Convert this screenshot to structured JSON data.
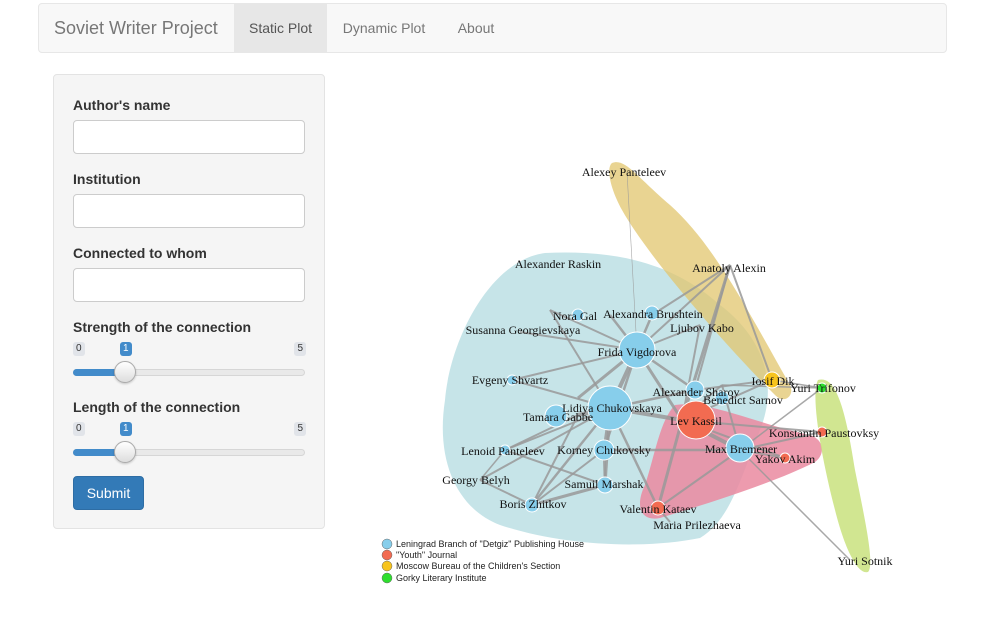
{
  "navbar": {
    "brand": "Soviet Writer Project",
    "tabs": [
      {
        "label": "Static Plot",
        "active": true
      },
      {
        "label": "Dynamic Plot",
        "active": false
      },
      {
        "label": "About",
        "active": false
      }
    ]
  },
  "form": {
    "author_label": "Author's name",
    "author_value": "",
    "institution_label": "Institution",
    "institution_value": "",
    "connected_label": "Connected to whom",
    "connected_value": "",
    "strength": {
      "label": "Strength of the connection",
      "min": "0",
      "max": "5",
      "value": "1"
    },
    "length": {
      "label": "Length of the connection",
      "min": "0",
      "max": "5",
      "value": "1"
    },
    "submit_label": "Submit"
  },
  "colors": {
    "leningrad": "#87ceeb",
    "youth": "#f26b51",
    "moscow": "#f7c41d",
    "gorky": "#2ede2e",
    "accent": "#337ab7"
  },
  "graph": {
    "nodes": [
      {
        "id": "alexey_panteleev",
        "label": "Alexey Panteleev",
        "group": "none"
      },
      {
        "id": "alexander_raskin",
        "label": "Alexander Raskin",
        "group": "none"
      },
      {
        "id": "anatoly_alexin",
        "label": "Anatoly Alexin",
        "group": "none"
      },
      {
        "id": "nora_gal",
        "label": "Nora Gal",
        "group": "leningrad"
      },
      {
        "id": "alexandra_brushtein",
        "label": "Alexandra Brushtein",
        "group": "leningrad"
      },
      {
        "id": "susanna_georgievskaya",
        "label": "Susanna Georgievskaya",
        "group": "none"
      },
      {
        "id": "ljubov_kabo",
        "label": "Ljubov Kabo",
        "group": "none"
      },
      {
        "id": "frida_vigdorova",
        "label": "Frida Vigdorova",
        "group": "leningrad"
      },
      {
        "id": "evgeny_shvartz",
        "label": "Evgeny Shvartz",
        "group": "leningrad"
      },
      {
        "id": "alexander_sharov",
        "label": "Alexander Sharov",
        "group": "leningrad"
      },
      {
        "id": "iosif_dik",
        "label": "Iosif Dik",
        "group": "moscow"
      },
      {
        "id": "yuri_trifonov",
        "label": "Yuri Trifonov",
        "group": "gorky"
      },
      {
        "id": "benedict_sarnov",
        "label": "Benedict Sarnov",
        "group": "leningrad"
      },
      {
        "id": "lidiya_chukovskaya",
        "label": "Lidiya Chukovskaya",
        "group": "leningrad"
      },
      {
        "id": "tamara_gabbe",
        "label": "Tamara Gabbe",
        "group": "leningrad"
      },
      {
        "id": "lev_kassil",
        "label": "Lev Kassil",
        "group": "youth"
      },
      {
        "id": "konstantin_paustovsky",
        "label": "Konstantin Paustovksy",
        "group": "youth"
      },
      {
        "id": "max_bremener",
        "label": "Max Bremener",
        "group": "leningrad"
      },
      {
        "id": "yakov_akim",
        "label": "Yakov Akim",
        "group": "youth"
      },
      {
        "id": "lenoid_panteleev",
        "label": "Lenoid Panteleev",
        "group": "leningrad"
      },
      {
        "id": "korney_chukovsky",
        "label": "Korney Chukovsky",
        "group": "leningrad"
      },
      {
        "id": "georgy_belyh",
        "label": "Georgy Belyh",
        "group": "none"
      },
      {
        "id": "samuil_marshak",
        "label": "Samuil Marshak",
        "group": "leningrad"
      },
      {
        "id": "boris_zhitkov",
        "label": "Boris Zhitkov",
        "group": "leningrad"
      },
      {
        "id": "valentin_kataev",
        "label": "Valentin Kataev",
        "group": "youth"
      },
      {
        "id": "maria_prilezhaeva",
        "label": "Maria Prilezhaeva",
        "group": "none"
      },
      {
        "id": "yuri_sotnik",
        "label": "Yuri Sotnik",
        "group": "none"
      }
    ]
  },
  "legend": [
    {
      "label": "Leningrad Branch of \"Detgiz\" Publishing House",
      "color": "#87ceeb"
    },
    {
      "label": "\"Youth\" Journal",
      "color": "#f26b51"
    },
    {
      "label": "Moscow Bureau of the Children's Section",
      "color": "#f7c41d"
    },
    {
      "label": "Gorky Literary Institute",
      "color": "#2ede2e"
    }
  ]
}
